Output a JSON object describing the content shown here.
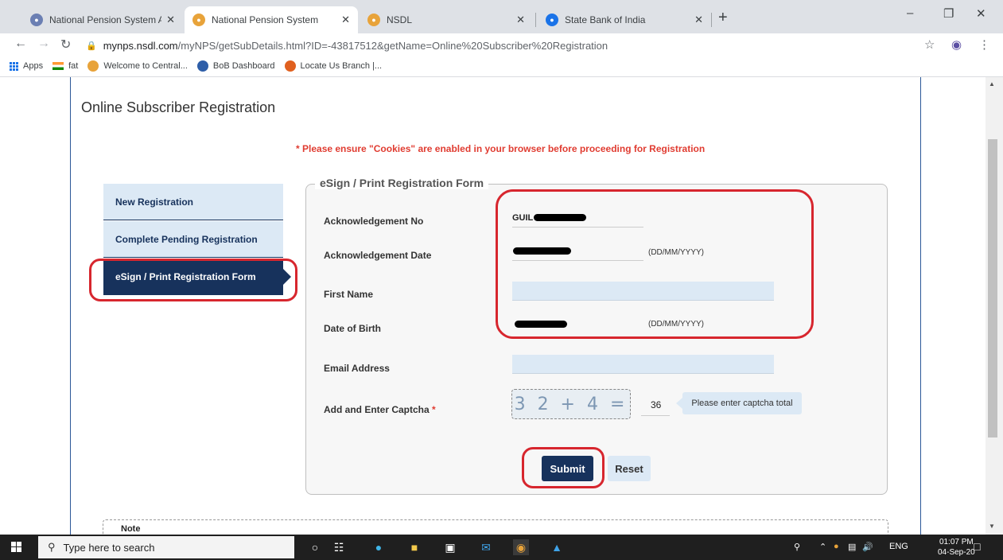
{
  "browser": {
    "tabs": [
      {
        "title": "National Pension System Agent, |",
        "active": false
      },
      {
        "title": "National Pension System",
        "active": true
      },
      {
        "title": "NSDL",
        "active": false
      },
      {
        "title": "State Bank of India",
        "active": false
      }
    ],
    "url": {
      "host": "mynps.nsdl.com",
      "path": "/myNPS/getSubDetails.html?ID=-43817512&getName=Online%20Subscriber%20Registration"
    },
    "bookmarks": [
      "Apps",
      "fat",
      "Welcome to Central...",
      "BoB Dashboard",
      "Locate Us Branch |..."
    ]
  },
  "page": {
    "title": "Online Subscriber Registration",
    "cookie_note": "* Please ensure \"Cookies\" are enabled in your browser before proceeding for Registration",
    "side_tabs": [
      {
        "label": "New Registration",
        "active": false
      },
      {
        "label": "Complete Pending Registration",
        "active": false
      },
      {
        "label": "eSign / Print Registration Form",
        "active": true
      }
    ],
    "form": {
      "legend": "eSign / Print Registration Form",
      "ack_no_label": "Acknowledgement No",
      "ack_no_value_prefix": "GUIL",
      "ack_date_label": "Acknowledgement Date",
      "date_format_hint": "(DD/MM/YYYY)",
      "first_name_label": "First Name",
      "first_name_value": "",
      "dob_label": "Date of Birth",
      "email_label": "Email Address",
      "email_value": "",
      "captcha_label": "Add and Enter Captcha",
      "captcha_required_mark": "*",
      "captcha_image_text": "3 2 + 4 =",
      "captcha_value": "36",
      "captcha_tooltip": "Please enter captcha total",
      "submit_label": "Submit",
      "reset_label": "Reset"
    },
    "note_label": "Note"
  },
  "taskbar": {
    "search_placeholder": "Type here to search",
    "language": "ENG",
    "time": "01:07 PM",
    "date": "04-Sep-20"
  },
  "colors": {
    "primary_navy": "#17325c",
    "light_blue": "#dce9f5",
    "alert_red": "#e03c31",
    "annotation_red": "#d7262e"
  }
}
